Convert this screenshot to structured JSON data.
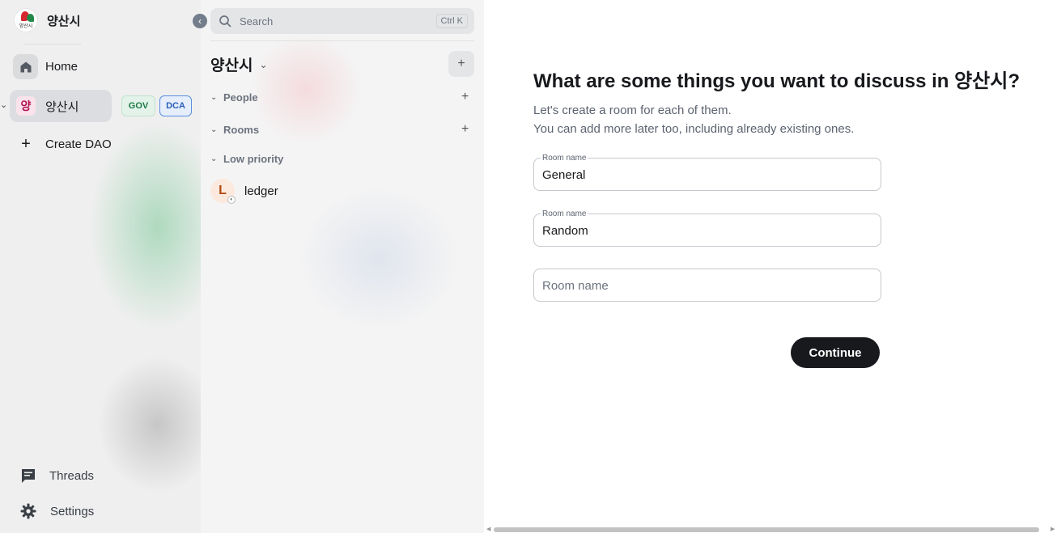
{
  "brand": {
    "name": "양산시",
    "logo_caption": "양산시"
  },
  "sidebar": {
    "collapse_icon": "chevron-left-icon",
    "home_label": "Home",
    "space": {
      "avatar_letter": "양",
      "name": "양산시"
    },
    "badges": {
      "gov": "GOV",
      "dca": "DCA"
    },
    "create_dao_label": "Create DAO",
    "threads_label": "Threads",
    "settings_label": "Settings"
  },
  "room_list": {
    "search_label": "Search",
    "search_shortcut": "Ctrl K",
    "space_title": "양산시",
    "sections": {
      "people": "People",
      "rooms": "Rooms",
      "low_priority": "Low priority"
    },
    "rooms": [
      {
        "avatar_letter": "L",
        "name": "ledger"
      }
    ]
  },
  "main": {
    "heading": "What are some things you want to discuss in 양산시?",
    "desc_line1": "Let's create a room for each of them.",
    "desc_line2": "You can add more later too, including already existing ones.",
    "fields": [
      {
        "legend": "Room name",
        "value": "General"
      },
      {
        "legend": "Room name",
        "value": "Random"
      },
      {
        "placeholder": "Room name",
        "value": ""
      }
    ],
    "continue_label": "Continue"
  }
}
